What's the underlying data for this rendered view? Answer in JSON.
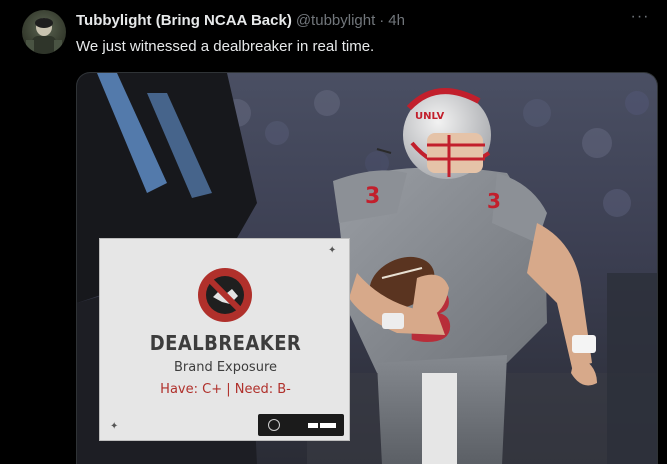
{
  "tweet": {
    "display_name": "Tubbylight (Bring NCAA Back)",
    "handle": "@tubbylight",
    "separator": "·",
    "timestamp": "4h",
    "more_icon": "more-horizontal-icon",
    "more_label": "···",
    "text": "We just witnessed a dealbreaker in real time."
  },
  "media": {
    "jersey_number": "3",
    "helmet_text": "UNLV",
    "card": {
      "title": "DEALBREAKER",
      "subtitle": "Brand Exposure",
      "grade": "Have: C+ | Need: B-",
      "icon": "no-handshake-icon",
      "accent_color": "#b0302b"
    }
  },
  "colors": {
    "background": "#000000",
    "text_primary": "#e7e9ea",
    "text_secondary": "#71767b"
  }
}
